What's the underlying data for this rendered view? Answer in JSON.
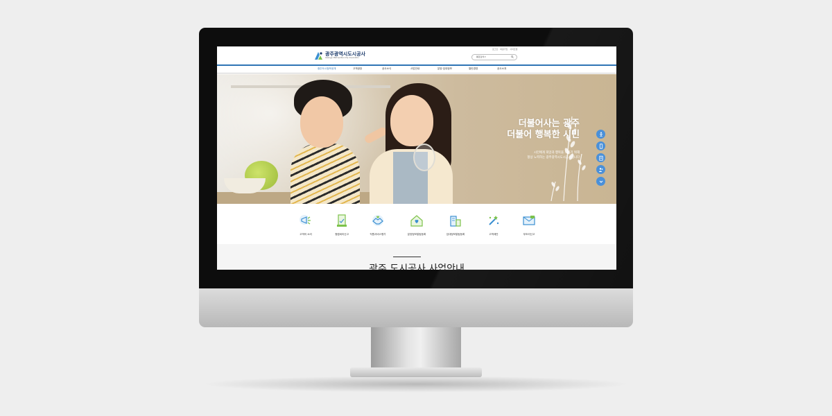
{
  "header": {
    "logo_name": "광주광역시도시공사",
    "logo_sub": "Gwangju Metropolitan City Corporation",
    "util_links": [
      "로그인",
      "회원가입",
      "사이트맵"
    ],
    "search_label": "통합검색 ▾"
  },
  "nav": {
    "items": [
      "광주도시정보공개",
      "고객광장",
      "공사소식",
      "사업안내",
      "분양·임대정보",
      "열린경영",
      "공사소개"
    ],
    "active_index": 0
  },
  "hero": {
    "title_line1": "더불어사는 광주",
    "title_line2": "더불어 행복한 시민",
    "sub_line1": "시민에게 희망과 행복을 드리기 위해",
    "sub_line2": "항상 노력하는 광주광역시도시공사입니다"
  },
  "quick_menu": [
    "accessibility-icon",
    "mobile-icon",
    "clipboard-icon",
    "people-icon",
    "chevron-down-icon"
  ],
  "services": [
    {
      "label": "고객의 소리",
      "icon": "megaphone-icon"
    },
    {
      "label": "청렴비리신고",
      "icon": "report-icon"
    },
    {
      "label": "직원서비스평가",
      "icon": "handshake-icon"
    },
    {
      "label": "분양정보알림등록",
      "icon": "house-heart-icon"
    },
    {
      "label": "임대정보알림등록",
      "icon": "apartment-icon"
    },
    {
      "label": "고객제안",
      "icon": "idea-icon"
    },
    {
      "label": "부조리신고",
      "icon": "mail-report-icon"
    }
  ],
  "section": {
    "title": "광주 도시공사 사업안내"
  },
  "colors": {
    "accent": "#2e74b5",
    "quick_menu": "#4a90d9",
    "icon_green": "#7cc24a",
    "icon_blue": "#3a8fd1"
  }
}
